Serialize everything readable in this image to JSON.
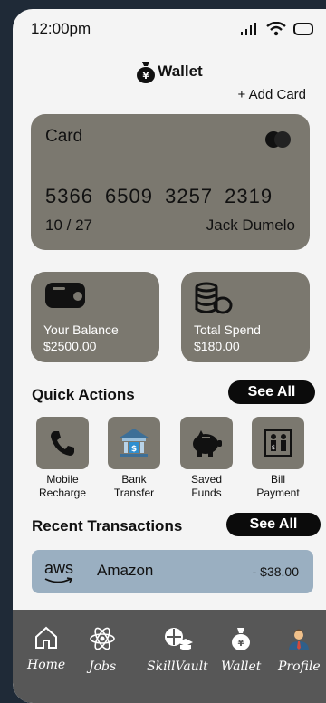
{
  "status": {
    "time": "12:00pm"
  },
  "header": {
    "title": "Wallet",
    "add_card": "+ Add Card"
  },
  "card": {
    "label": "Card",
    "number": "5366  6509  3257  2319",
    "expiry": "10 / 27",
    "holder": "Jack Dumelo"
  },
  "stats": {
    "balance": {
      "label": "Your Balance",
      "value": "$2500.00"
    },
    "spend": {
      "label": "Total Spend",
      "value": "$180.00"
    }
  },
  "quick_actions": {
    "title": "Quick Actions",
    "see_all": "See All",
    "items": [
      {
        "line1": "Mobile",
        "line2": "Recharge",
        "icon": "phone-icon"
      },
      {
        "line1": "Bank",
        "line2": "Transfer",
        "icon": "bank-icon"
      },
      {
        "line1": "Saved",
        "line2": "Funds",
        "icon": "piggy-bank-icon"
      },
      {
        "line1": "Bill",
        "line2": "Payment",
        "icon": "bill-payment-icon"
      }
    ]
  },
  "transactions": {
    "title": "Recent Transactions",
    "see_all": "See All",
    "items": [
      {
        "logo": "aws",
        "merchant": "Amazon",
        "amount": "- $38.00"
      }
    ]
  },
  "nav": {
    "items": [
      {
        "label": "Home",
        "icon": "home-icon"
      },
      {
        "label": "Jobs",
        "icon": "atom-icon"
      },
      {
        "label": "SkillVault",
        "icon": "skillvault-icon"
      },
      {
        "label": "Wallet",
        "icon": "money-bag-icon"
      },
      {
        "label": "Profile",
        "icon": "person-icon"
      }
    ]
  },
  "colors": {
    "card": "#7b786f",
    "transaction": "#9aafc1",
    "nav": "#575757",
    "button": "#0b0b0b"
  }
}
